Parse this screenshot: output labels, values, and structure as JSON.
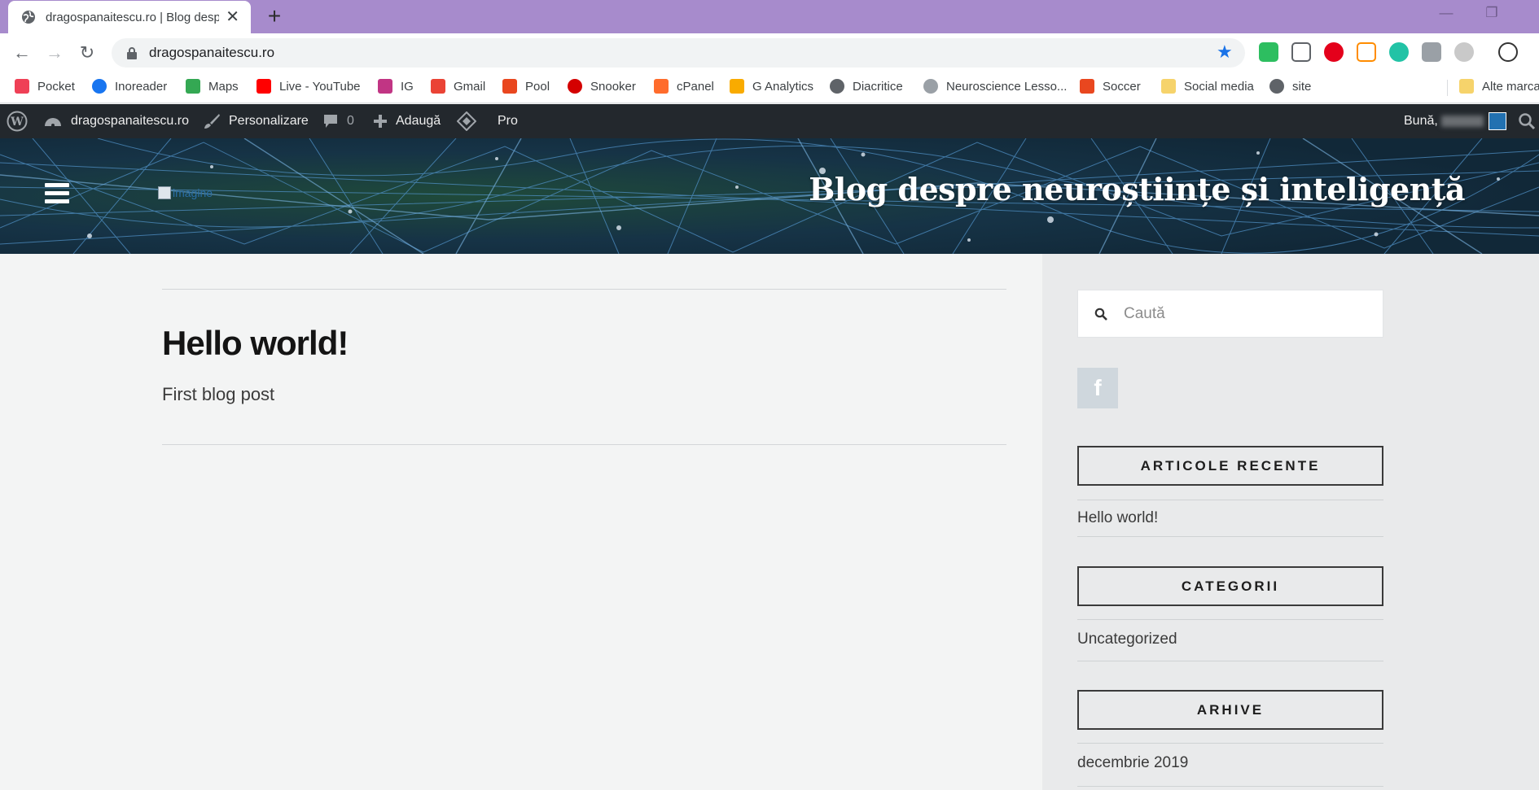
{
  "browser": {
    "tab_title": "dragospanaitescu.ro | Blog despre neuroștiințe și inteligență",
    "tab_close": "✕",
    "new_tab": "+",
    "url": "dragospanaitescu.ro",
    "star": "★",
    "win_minimize": "—",
    "win_restore": "❐",
    "nav_back": "←",
    "nav_forward": "→",
    "nav_reload": "↻"
  },
  "bookmarks": [
    {
      "label": "Pocket",
      "icon": "pocket-icon",
      "color": "#ef4056"
    },
    {
      "label": "Inoreader",
      "icon": "inoreader-icon",
      "color": "#1875f0"
    },
    {
      "label": "Maps",
      "icon": "maps-icon",
      "color": "#34a853"
    },
    {
      "label": "Live - YouTube",
      "icon": "youtube-icon",
      "color": "#ff0000"
    },
    {
      "label": "IG",
      "icon": "instagram-icon",
      "color": "#c13584"
    },
    {
      "label": "Gmail",
      "icon": "gmail-icon",
      "color": "#ea4335"
    },
    {
      "label": "Pool",
      "icon": "pool-icon",
      "color": "#e9471f"
    },
    {
      "label": "Snooker",
      "icon": "snooker-icon",
      "color": "#d40000"
    },
    {
      "label": "cPanel",
      "icon": "cpanel-icon",
      "color": "#ff6c2c"
    },
    {
      "label": "G Analytics",
      "icon": "analytics-icon",
      "color": "#f9ab00"
    },
    {
      "label": "Diacritice",
      "icon": "globe-icon",
      "color": "#5f6368"
    },
    {
      "label": "Neuroscience Lesso...",
      "icon": "brain-icon",
      "color": "#9aa0a6"
    },
    {
      "label": "Soccer",
      "icon": "soccer-icon",
      "color": "#e9471f"
    },
    {
      "label": "Social media",
      "icon": "folder-icon",
      "color": "#f6d36b"
    },
    {
      "label": "site",
      "icon": "globe-icon",
      "color": "#5f6368"
    },
    {
      "label": "Alte marca",
      "icon": "folder-icon",
      "color": "#f6d36b"
    }
  ],
  "adminbar": {
    "site_name": "dragospanaitescu.ro",
    "customize": "Personalizare",
    "comments_count": "0",
    "add_new": "Adaugă",
    "pro": "Pro",
    "greeting": "Bună, "
  },
  "header": {
    "logo_alt": "imagine",
    "site_title": "Blog despre neuroștiințe și inteligență"
  },
  "post": {
    "title": "Hello world!",
    "excerpt": "First blog post"
  },
  "sidebar": {
    "search_placeholder": "Caută",
    "facebook": "f",
    "recent_title": "ARTICOLE RECENTE",
    "recent_item": "Hello world!",
    "categories_title": "CATEGORII",
    "categories_item": "Uncategorized",
    "archives_title": "ARHIVE",
    "archives_item": "decembrie 2019"
  },
  "colors": {
    "tabstrip": "#a78bcc",
    "adminbar": "#23282d",
    "accent_star": "#1a73e8"
  }
}
